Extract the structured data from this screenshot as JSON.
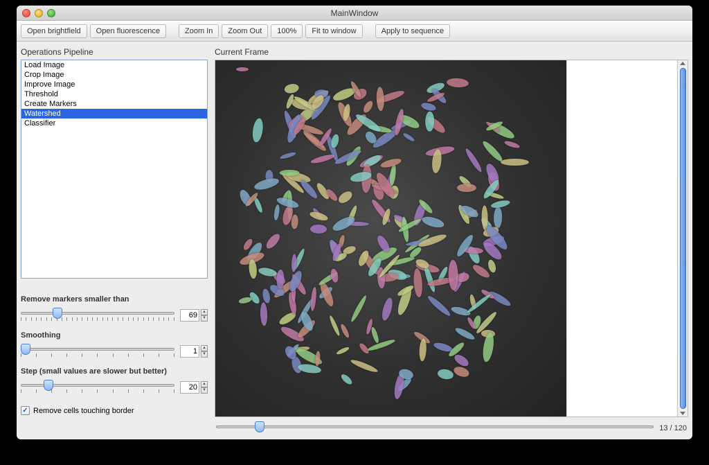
{
  "window": {
    "title": "MainWindow"
  },
  "toolbar": {
    "open_brightfield": "Open brightfield",
    "open_fluorescence": "Open fluorescence",
    "zoom_in": "Zoom In",
    "zoom_out": "Zoom Out",
    "zoom_100": "100%",
    "fit": "Fit to window",
    "apply_seq": "Apply to sequence"
  },
  "left": {
    "pipeline_label": "Operations Pipeline",
    "pipeline_items": [
      {
        "label": "Load Image",
        "selected": false
      },
      {
        "label": "Crop Image",
        "selected": false
      },
      {
        "label": "Improve Image",
        "selected": false
      },
      {
        "label": "Threshold",
        "selected": false
      },
      {
        "label": "Create Markers",
        "selected": false
      },
      {
        "label": "Watershed",
        "selected": true
      },
      {
        "label": "Classifier",
        "selected": false
      }
    ],
    "param_remove_label": "Remove markers smaller than",
    "param_remove_value": "69",
    "param_remove_pos_pct": 24,
    "param_smoothing_label": "Smoothing",
    "param_smoothing_value": "1",
    "param_smoothing_pos_pct": 3,
    "param_step_label": "Step (small values are slower but better)",
    "param_step_value": "20",
    "param_step_pos_pct": 18,
    "checkbox_checked": true,
    "checkbox_label": "Remove cells touching border"
  },
  "right": {
    "frame_label": "Current Frame",
    "frame_pos_pct": 10,
    "frame_current": "13",
    "frame_total": "120",
    "frame_sep": " / "
  }
}
